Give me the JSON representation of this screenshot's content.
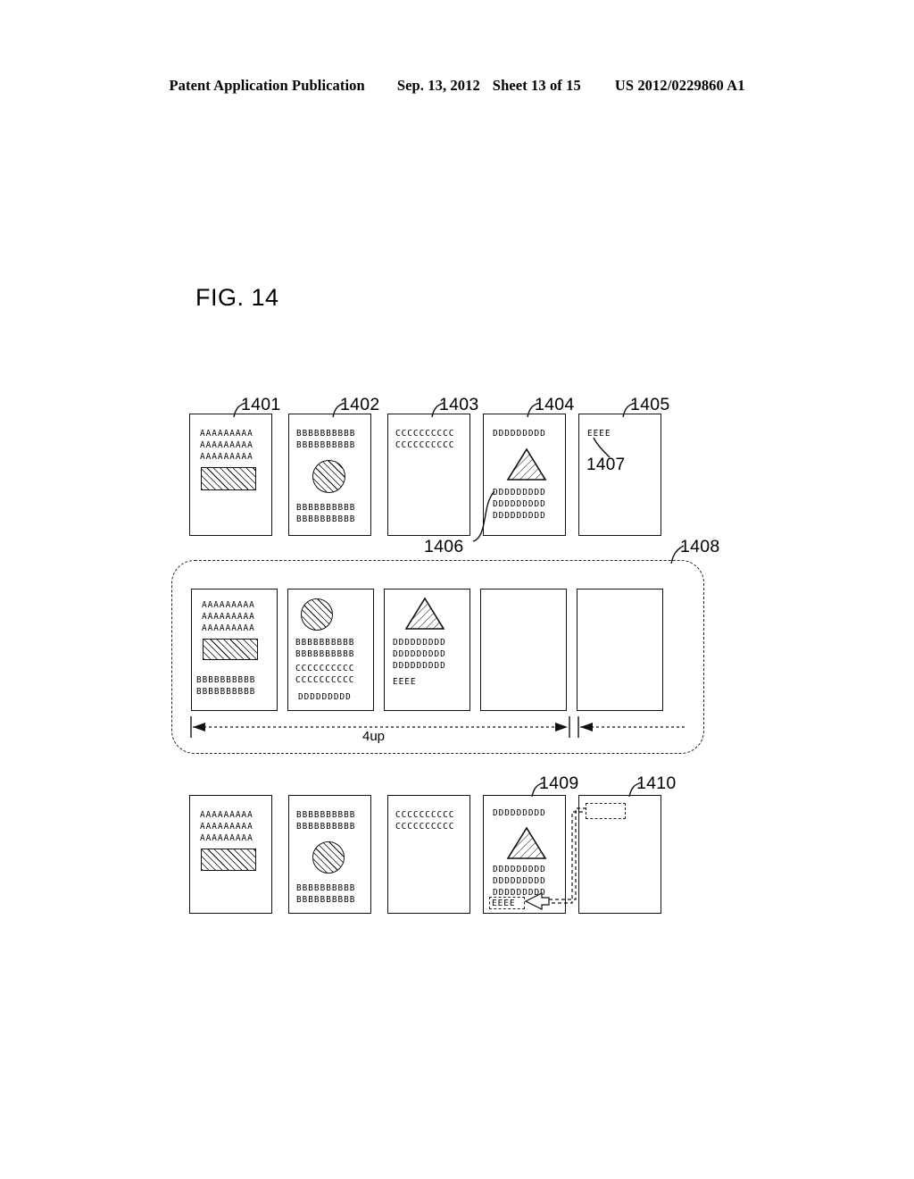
{
  "header": {
    "publication": "Patent Application Publication",
    "date": "Sep. 13, 2012",
    "sheet": "Sheet 13 of 15",
    "number": "US 2012/0229860 A1"
  },
  "figure": {
    "title": "FIG. 14"
  },
  "labels": {
    "r1401": "1401",
    "r1402": "1402",
    "r1403": "1403",
    "r1404": "1404",
    "r1405": "1405",
    "r1406": "1406",
    "r1407": "1407",
    "r1408": "1408",
    "r1409": "1409",
    "r1410": "1410"
  },
  "dimension": {
    "label_4up": "4up"
  },
  "text_blocks": {
    "a_line": "AAAAAAAAA",
    "b_line": "BBBBBBBBBB",
    "c_line": "CCCCCCCCCC",
    "d_line": "DDDDDDDDD",
    "e_line": "EEEE"
  },
  "row_top": {
    "pages": [
      {
        "ref": "1401",
        "lines_top": [
          "AAAAAAAAA",
          "AAAAAAAAA",
          "AAAAAAAAA"
        ],
        "shape": "hatched-rectangle",
        "lines_bottom": []
      },
      {
        "ref": "1402",
        "lines_top": [
          "BBBBBBBBBB",
          "BBBBBBBBBB"
        ],
        "shape": "hatched-circle",
        "lines_bottom": [
          "BBBBBBBBBB",
          "BBBBBBBBBB"
        ]
      },
      {
        "ref": "1403",
        "lines_top": [
          "CCCCCCCCCC",
          "CCCCCCCCCC"
        ],
        "shape": "none",
        "lines_bottom": []
      },
      {
        "ref": "1404",
        "lines_top": [
          "DDDDDDDDD"
        ],
        "shape": "hatched-triangle",
        "lines_bottom": [
          "DDDDDDDDD",
          "DDDDDDDDD",
          "DDDDDDDDD"
        ]
      },
      {
        "ref": "1405",
        "lines_top": [
          "EEEE"
        ],
        "shape": "none",
        "lines_bottom": [],
        "inner_ref": "1407"
      }
    ]
  },
  "row_middle": {
    "group_ref": "1408",
    "pages": [
      {
        "lines_top": [
          "AAAAAAAAA",
          "AAAAAAAAA",
          "AAAAAAAAA"
        ],
        "shape": "hatched-rectangle",
        "lines_bottom": [
          "BBBBBBBBBB",
          "BBBBBBBBBB"
        ]
      },
      {
        "lines_top": [],
        "shape": "hatched-circle",
        "lines_bottom": [
          "BBBBBBBBBB",
          "BBBBBBBBBB",
          "CCCCCCCCCC",
          "CCCCCCCCCC",
          "DDDDDDDDD"
        ]
      },
      {
        "lines_top": [],
        "shape": "hatched-triangle",
        "lines_bottom": [
          "DDDDDDDDD",
          "DDDDDDDDD",
          "DDDDDDDDD",
          "EEEE"
        ]
      },
      {
        "lines_top": [],
        "shape": "none",
        "lines_bottom": []
      },
      {
        "lines_top": [],
        "shape": "none",
        "lines_bottom": []
      }
    ]
  },
  "row_bottom": {
    "pages": [
      {
        "lines_top": [
          "AAAAAAAAA",
          "AAAAAAAAA",
          "AAAAAAAAA"
        ],
        "shape": "hatched-rectangle",
        "lines_bottom": []
      },
      {
        "lines_top": [
          "BBBBBBBBBB",
          "BBBBBBBBBB"
        ],
        "shape": "hatched-circle",
        "lines_bottom": [
          "BBBBBBBBBB",
          "BBBBBBBBBB"
        ]
      },
      {
        "lines_top": [
          "CCCCCCCCCC",
          "CCCCCCCCCC"
        ],
        "shape": "none",
        "lines_bottom": []
      },
      {
        "ref": "1409",
        "lines_top": [
          "DDDDDDDDD"
        ],
        "shape": "hatched-triangle",
        "lines_bottom": [
          "DDDDDDDDD",
          "DDDDDDDDD",
          "DDDDDDDDD"
        ],
        "moved_text": "EEEE"
      },
      {
        "ref": "1410",
        "lines_top": [],
        "shape": "none",
        "lines_bottom": [],
        "ghost_placeholder": "EEEE"
      }
    ]
  },
  "colors": {
    "ink": "#111111",
    "paper": "#ffffff"
  }
}
